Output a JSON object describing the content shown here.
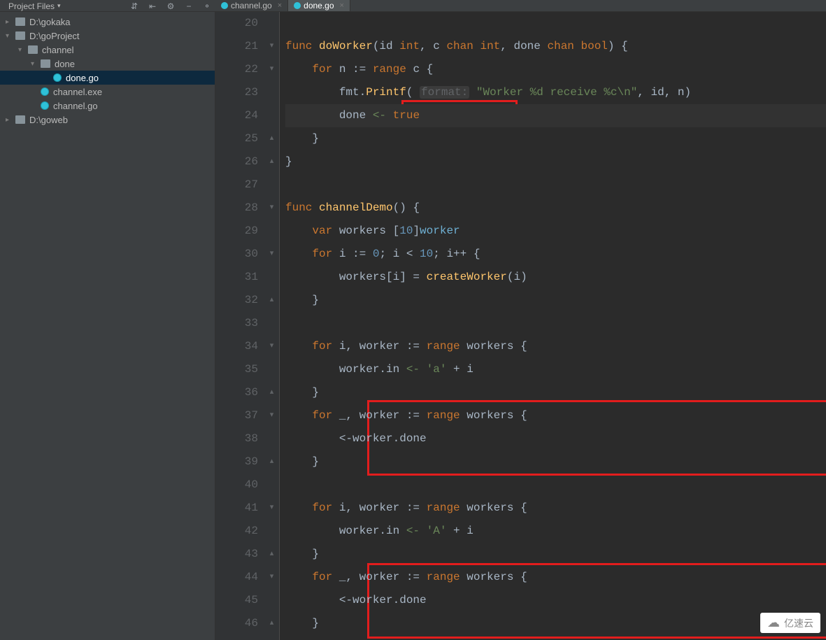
{
  "sidebar": {
    "dropdown_label": "Project Files",
    "toolbar": [
      "⇄",
      "↔",
      "⚙",
      "−",
      "⚬"
    ],
    "tree": [
      {
        "indent": 0,
        "arrow": "right",
        "icon": "drive",
        "label": "D:\\gokaka"
      },
      {
        "indent": 0,
        "arrow": "down",
        "icon": "drive",
        "label": "D:\\goProject"
      },
      {
        "indent": 1,
        "arrow": "down",
        "icon": "folder",
        "label": "channel"
      },
      {
        "indent": 2,
        "arrow": "down",
        "icon": "folder",
        "label": "done"
      },
      {
        "indent": 3,
        "arrow": "",
        "icon": "go",
        "label": "done.go",
        "selected": true
      },
      {
        "indent": 2,
        "arrow": "",
        "icon": "go",
        "label": "channel.exe"
      },
      {
        "indent": 2,
        "arrow": "",
        "icon": "go",
        "label": "channel.go"
      },
      {
        "indent": 0,
        "arrow": "right",
        "icon": "drive",
        "label": "D:\\goweb"
      }
    ]
  },
  "tabs": [
    {
      "label": "channel.go",
      "active": false
    },
    {
      "label": "done.go",
      "active": true
    }
  ],
  "editor": {
    "first_line": 20,
    "current_line": 24,
    "lines": [
      {
        "n": 20,
        "fold": "",
        "segs": []
      },
      {
        "n": 21,
        "fold": "▾",
        "segs": [
          {
            "t": "func ",
            "c": "kw"
          },
          {
            "t": "doWorker",
            "c": "fn"
          },
          {
            "t": "(id ",
            "c": "id"
          },
          {
            "t": "int",
            "c": "kw"
          },
          {
            "t": ", c ",
            "c": "id"
          },
          {
            "t": "chan int",
            "c": "kw"
          },
          {
            "t": ", done ",
            "c": "id"
          },
          {
            "t": "chan bool",
            "c": "kw"
          },
          {
            "t": ") {",
            "c": "id"
          }
        ]
      },
      {
        "n": 22,
        "fold": "▾",
        "segs": [
          {
            "t": "    ",
            "c": ""
          },
          {
            "t": "for ",
            "c": "kw"
          },
          {
            "t": "n := ",
            "c": "id"
          },
          {
            "t": "range ",
            "c": "kw"
          },
          {
            "t": "c {",
            "c": "id"
          }
        ]
      },
      {
        "n": 23,
        "fold": "",
        "segs": [
          {
            "t": "        fmt.",
            "c": "id"
          },
          {
            "t": "Printf",
            "c": "fn"
          },
          {
            "t": "( ",
            "c": "id"
          },
          {
            "t": "format:",
            "c": "hint"
          },
          {
            "t": " ",
            "c": ""
          },
          {
            "t": "\"Worker %d receive %c\\n\"",
            "c": "str"
          },
          {
            "t": ", id, n)",
            "c": "id"
          }
        ]
      },
      {
        "n": 24,
        "fold": "",
        "segs": [
          {
            "t": "        done ",
            "c": "id"
          },
          {
            "t": "<- ",
            "c": "str"
          },
          {
            "t": "true",
            "c": "kw"
          }
        ]
      },
      {
        "n": 25,
        "fold": "▴",
        "segs": [
          {
            "t": "    }",
            "c": "id"
          }
        ]
      },
      {
        "n": 26,
        "fold": "▴",
        "segs": [
          {
            "t": "}",
            "c": "id"
          }
        ]
      },
      {
        "n": 27,
        "fold": "",
        "segs": []
      },
      {
        "n": 28,
        "fold": "▾",
        "segs": [
          {
            "t": "func ",
            "c": "kw"
          },
          {
            "t": "channelDemo",
            "c": "fn"
          },
          {
            "t": "() {",
            "c": "id"
          }
        ]
      },
      {
        "n": 29,
        "fold": "",
        "segs": [
          {
            "t": "    ",
            "c": ""
          },
          {
            "t": "var ",
            "c": "kw"
          },
          {
            "t": "workers [",
            "c": "id"
          },
          {
            "t": "10",
            "c": "num"
          },
          {
            "t": "]",
            "c": "id"
          },
          {
            "t": "worker",
            "c": "ty"
          }
        ]
      },
      {
        "n": 30,
        "fold": "▾",
        "segs": [
          {
            "t": "    ",
            "c": ""
          },
          {
            "t": "for ",
            "c": "kw"
          },
          {
            "t": "i := ",
            "c": "id"
          },
          {
            "t": "0",
            "c": "num"
          },
          {
            "t": "; i < ",
            "c": "id"
          },
          {
            "t": "10",
            "c": "num"
          },
          {
            "t": "; i++ {",
            "c": "id"
          }
        ]
      },
      {
        "n": 31,
        "fold": "",
        "segs": [
          {
            "t": "        workers[i] = ",
            "c": "id"
          },
          {
            "t": "createWorker",
            "c": "fn"
          },
          {
            "t": "(i)",
            "c": "id"
          }
        ]
      },
      {
        "n": 32,
        "fold": "▴",
        "segs": [
          {
            "t": "    }",
            "c": "id"
          }
        ]
      },
      {
        "n": 33,
        "fold": "",
        "segs": []
      },
      {
        "n": 34,
        "fold": "▾",
        "segs": [
          {
            "t": "    ",
            "c": ""
          },
          {
            "t": "for ",
            "c": "kw"
          },
          {
            "t": "i, worker := ",
            "c": "id"
          },
          {
            "t": "range ",
            "c": "kw"
          },
          {
            "t": "workers {",
            "c": "id"
          }
        ]
      },
      {
        "n": 35,
        "fold": "",
        "segs": [
          {
            "t": "        worker.in ",
            "c": "id"
          },
          {
            "t": "<- ",
            "c": "str"
          },
          {
            "t": "'a'",
            "c": "str"
          },
          {
            "t": " + i",
            "c": "id"
          }
        ]
      },
      {
        "n": 36,
        "fold": "▴",
        "segs": [
          {
            "t": "    }",
            "c": "id"
          }
        ]
      },
      {
        "n": 37,
        "fold": "▾",
        "segs": [
          {
            "t": "    ",
            "c": ""
          },
          {
            "t": "for ",
            "c": "kw"
          },
          {
            "t": "_, worker := ",
            "c": "id"
          },
          {
            "t": "range ",
            "c": "kw"
          },
          {
            "t": "workers {",
            "c": "id"
          }
        ]
      },
      {
        "n": 38,
        "fold": "",
        "segs": [
          {
            "t": "        <-worker.done",
            "c": "id"
          }
        ]
      },
      {
        "n": 39,
        "fold": "▴",
        "segs": [
          {
            "t": "    }",
            "c": "id"
          }
        ]
      },
      {
        "n": 40,
        "fold": "",
        "segs": []
      },
      {
        "n": 41,
        "fold": "▾",
        "segs": [
          {
            "t": "    ",
            "c": ""
          },
          {
            "t": "for ",
            "c": "kw"
          },
          {
            "t": "i, worker := ",
            "c": "id"
          },
          {
            "t": "range ",
            "c": "kw"
          },
          {
            "t": "workers {",
            "c": "id"
          }
        ]
      },
      {
        "n": 42,
        "fold": "",
        "segs": [
          {
            "t": "        worker.in ",
            "c": "id"
          },
          {
            "t": "<- ",
            "c": "str"
          },
          {
            "t": "'A'",
            "c": "str"
          },
          {
            "t": " + i",
            "c": "id"
          }
        ]
      },
      {
        "n": 43,
        "fold": "▴",
        "segs": [
          {
            "t": "    }",
            "c": "id"
          }
        ]
      },
      {
        "n": 44,
        "fold": "▾",
        "segs": [
          {
            "t": "    ",
            "c": ""
          },
          {
            "t": "for ",
            "c": "kw"
          },
          {
            "t": "_, worker := ",
            "c": "id"
          },
          {
            "t": "range ",
            "c": "kw"
          },
          {
            "t": "workers {",
            "c": "id"
          }
        ]
      },
      {
        "n": 45,
        "fold": "",
        "segs": [
          {
            "t": "        <-worker.done",
            "c": "id"
          }
        ]
      },
      {
        "n": 46,
        "fold": "▴",
        "segs": [
          {
            "t": "    }",
            "c": "id"
          }
        ]
      }
    ]
  },
  "watermark": "亿速云"
}
